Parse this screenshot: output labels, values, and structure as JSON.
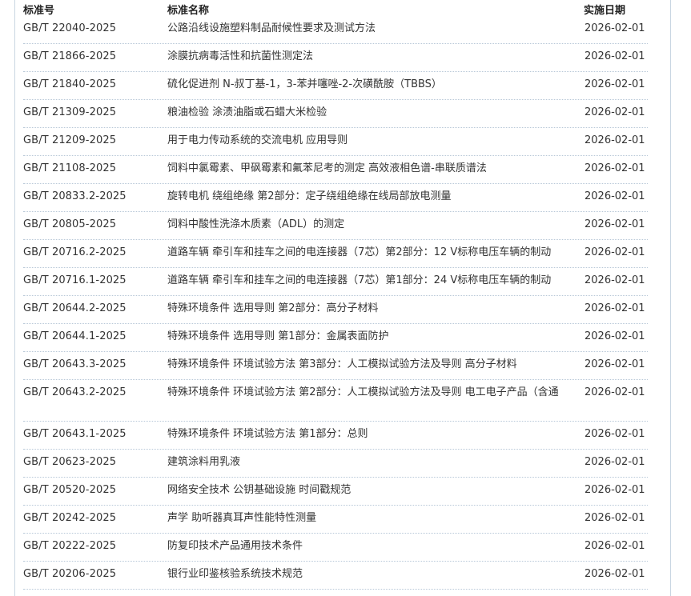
{
  "columns": {
    "code": "标准号",
    "name": "标准名称",
    "date": "实施日期"
  },
  "rows": [
    {
      "code": "GB/T 22040-2025",
      "name": "公路沿线设施塑料制品耐候性要求及测试方法",
      "date": "2026-02-01"
    },
    {
      "code": "GB/T 21866-2025",
      "name": "涂膜抗病毒活性和抗菌性测定法",
      "date": "2026-02-01"
    },
    {
      "code": "GB/T 21840-2025",
      "name": "硫化促进剂 N-叔丁基-1，3-苯并噻唑-2-次磺酰胺（TBBS）",
      "date": "2026-02-01"
    },
    {
      "code": "GB/T 21309-2025",
      "name": "粮油检验 涂渍油脂或石蜡大米检验",
      "date": "2026-02-01"
    },
    {
      "code": "GB/T 21209-2025",
      "name": "用于电力传动系统的交流电机 应用导则",
      "date": "2026-02-01"
    },
    {
      "code": "GB/T 21108-2025",
      "name": "饲料中氯霉素、甲砜霉素和氟苯尼考的测定 高效液相色谱-串联质谱法",
      "date": "2026-02-01"
    },
    {
      "code": "GB/T 20833.2-2025",
      "name": "旋转电机 绕组绝缘 第2部分：定子绕组绝缘在线局部放电测量",
      "date": "2026-02-01"
    },
    {
      "code": "GB/T 20805-2025",
      "name": "饲料中酸性洗涤木质素（ADL）的测定",
      "date": "2026-02-01"
    },
    {
      "code": "GB/T 20716.2-2025",
      "name": "道路车辆 牵引车和挂车之间的电连接器（7芯）第2部分：12 V标称电压车辆的制动",
      "date": "2026-02-01"
    },
    {
      "code": "GB/T 20716.1-2025",
      "name": "道路车辆 牵引车和挂车之间的电连接器（7芯）第1部分：24 V标称电压车辆的制动",
      "date": "2026-02-01"
    },
    {
      "code": "GB/T 20644.2-2025",
      "name": "特殊环境条件 选用导则 第2部分：高分子材料",
      "date": "2026-02-01"
    },
    {
      "code": "GB/T 20644.1-2025",
      "name": "特殊环境条件 选用导则 第1部分：金属表面防护",
      "date": "2026-02-01"
    },
    {
      "code": "GB/T 20643.3-2025",
      "name": "特殊环境条件 环境试验方法 第3部分：人工模拟试验方法及导则 高分子材料",
      "date": "2026-02-01"
    },
    {
      "code": "GB/T 20643.2-2025",
      "name": "特殊环境条件 环境试验方法 第2部分：人工模拟试验方法及导则 电工电子产品（含通",
      "date": "2026-02-01"
    },
    {
      "code": "GB/T 20643.1-2025",
      "name": "特殊环境条件 环境试验方法 第1部分：总则",
      "date": "2026-02-01"
    },
    {
      "code": "GB/T 20623-2025",
      "name": "建筑涂料用乳液",
      "date": "2026-02-01"
    },
    {
      "code": "GB/T 20520-2025",
      "name": "网络安全技术 公钥基础设施 时间戳规范",
      "date": "2026-02-01"
    },
    {
      "code": "GB/T 20242-2025",
      "name": "声学 助听器真耳声性能特性测量",
      "date": "2026-02-01"
    },
    {
      "code": "GB/T 20222-2025",
      "name": "防复印技术产品通用技术条件",
      "date": "2026-02-01"
    },
    {
      "code": "GB/T 20206-2025",
      "name": "银行业印鉴核验系统技术规范",
      "date": "2026-02-01"
    }
  ]
}
